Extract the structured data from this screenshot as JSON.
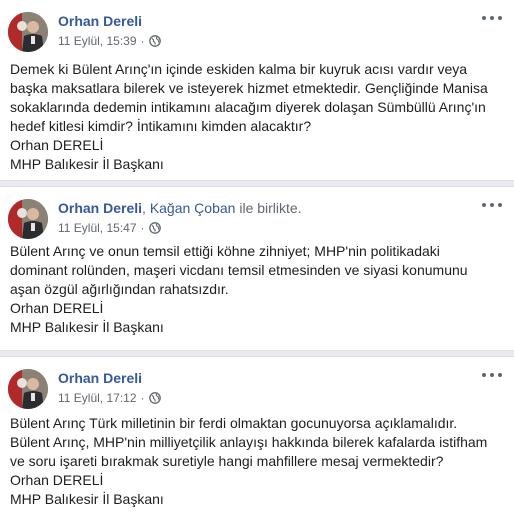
{
  "posts": [
    {
      "author": "Orhan Dereli",
      "with_prefix": "",
      "tagged": "",
      "with_suffix": "",
      "time": "11 Eylül, 15:39",
      "separator": "·",
      "privacy_icon": "globe-icon",
      "lines": [
        "Demek ki Bülent Arınç'ın içinde eskiden kalma bir kuyruk acısı vardır veya",
        "başka maksatlara bilerek ve isteyerek hizmet etmektedir. Gençliğinde Manisa",
        "sokaklarında dedemin intikamını alacağım diyerek dolaşan Sümbüllü Arınç'ın",
        "hedef kitlesi kimdir? İntikamını kimden alacaktır?",
        "Orhan DERELİ",
        "MHP Balıkesir İl Başkanı"
      ]
    },
    {
      "author": "Orhan Dereli",
      "with_prefix": ", ",
      "tagged": "Kağan Çoban",
      "with_suffix": " ile birlikte.",
      "time": "11 Eylül, 15:47",
      "separator": "·",
      "privacy_icon": "globe-icon",
      "lines": [
        "Bülent Arınç ve onun temsil ettiği köhne zihniyet; MHP'nin politikadaki",
        "dominant rolünden, maşeri vicdanı temsil etmesinden ve siyasi konumunu",
        "aşan özgül ağırlığından rahatsızdır.",
        "Orhan DERELİ",
        "MHP Balıkesir İl Başkanı"
      ]
    },
    {
      "author": "Orhan Dereli",
      "with_prefix": "",
      "tagged": "",
      "with_suffix": "",
      "time": "11 Eylül, 17:12",
      "separator": "·",
      "privacy_icon": "globe-icon",
      "lines": [
        "Bülent Arınç Türk milletinin bir ferdi olmaktan gocunuyorsa açıklamalıdır.",
        "Bülent Arınç, MHP'nin milliyetçilik anlayışı hakkında bilerek kafalarda istifham",
        "ve soru işareti bırakmak suretiyle hangi mahfillere mesaj vermektedir?",
        "Orhan DERELİ",
        "MHP Balıkesir İl Başkanı"
      ]
    }
  ],
  "colors": {
    "author_link": "#365899",
    "meta_text": "#616770",
    "body_text": "#1c1e21",
    "separator_bg": "#e9ebee"
  }
}
